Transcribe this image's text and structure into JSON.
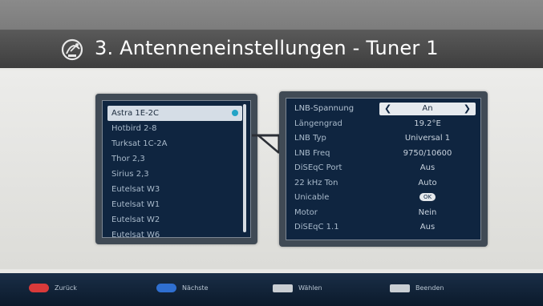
{
  "header": {
    "title": "3. Antenneneinstellungen - Tuner 1",
    "icon": "satellite-dish-icon"
  },
  "satellites": {
    "items": [
      {
        "label": "Astra 1E-2C",
        "selected": true
      },
      {
        "label": "Hotbird 2-8",
        "selected": false
      },
      {
        "label": "Turksat 1C-2A",
        "selected": false
      },
      {
        "label": "Thor 2,3",
        "selected": false
      },
      {
        "label": "Sirius 2,3",
        "selected": false
      },
      {
        "label": "Eutelsat W3",
        "selected": false
      },
      {
        "label": "Eutelsat W1",
        "selected": false
      },
      {
        "label": "Eutelsat W2",
        "selected": false
      },
      {
        "label": "Eutelsat W6",
        "selected": false
      }
    ],
    "indicator_color": "#23a3c6"
  },
  "settings": {
    "rows": [
      {
        "label": "LNB-Spannung",
        "value": "An"
      },
      {
        "label": "Längengrad",
        "value": "19.2°E"
      },
      {
        "label": "LNB Typ",
        "value": "Universal 1"
      },
      {
        "label": "LNB Freq",
        "value": "9750/10600"
      },
      {
        "label": "DiSEqC Port",
        "value": "Aus"
      },
      {
        "label": "22 kHz Ton",
        "value": "Auto"
      },
      {
        "label": "Unicable",
        "value": "OK"
      },
      {
        "label": "Motor",
        "value": "Nein"
      },
      {
        "label": "DiSEqC 1.1",
        "value": "Aus"
      }
    ]
  },
  "footer": {
    "hints": [
      {
        "key": "red-key",
        "color": "#d93a3a",
        "label": "Zurück"
      },
      {
        "key": "blue-key",
        "color": "#2f6fd0",
        "label": "Nächste"
      },
      {
        "key": "ok-key",
        "color": "#c9ced3",
        "label": "Wählen"
      },
      {
        "key": "exit-key",
        "color": "#c9ced3",
        "label": "Beenden"
      }
    ]
  },
  "colors": {
    "panel_bg": "#0f2540",
    "highlight": "#d5dde6",
    "footer_bg": "#0b1a2b"
  }
}
